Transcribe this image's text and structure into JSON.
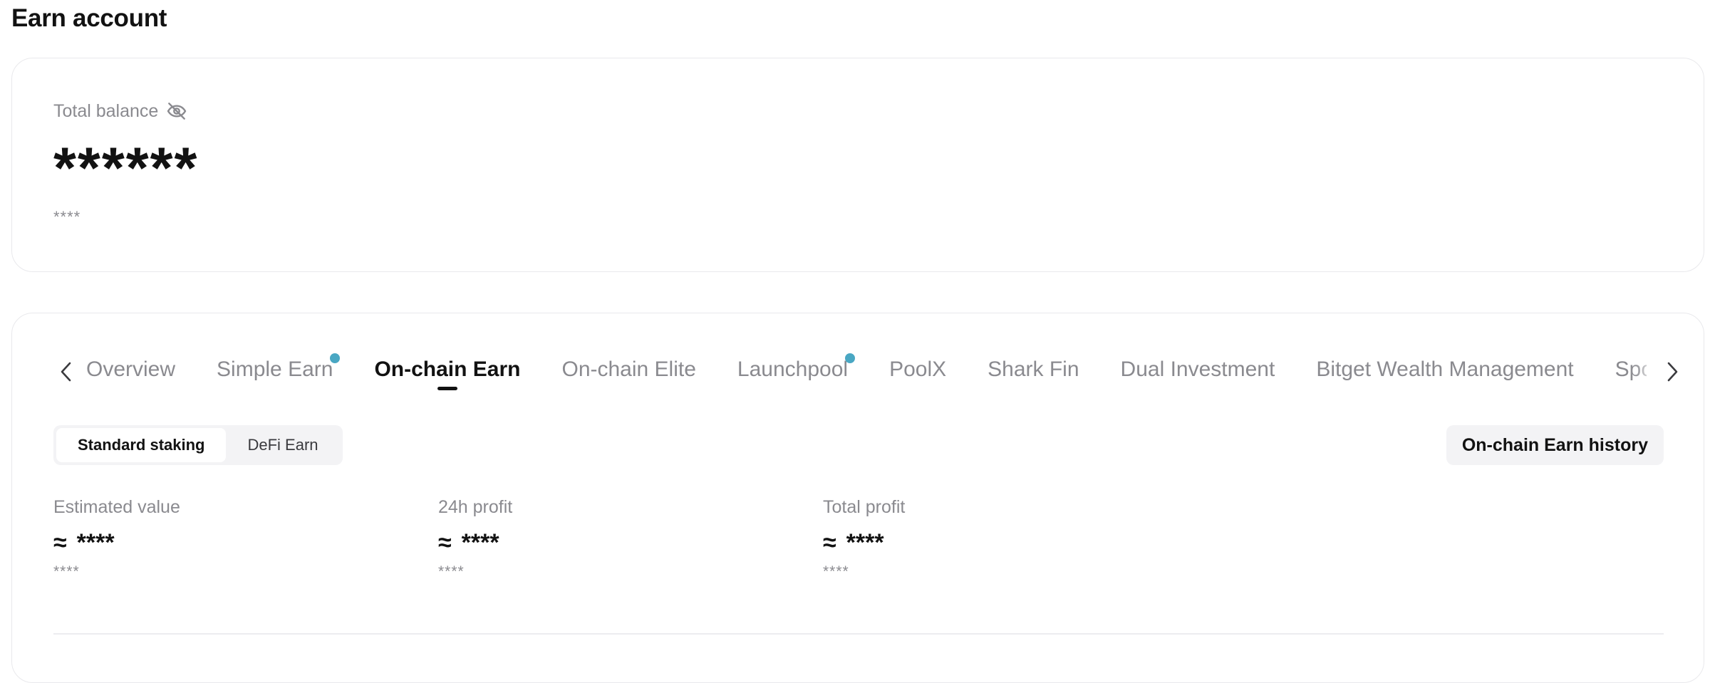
{
  "page": {
    "title": "Earn account"
  },
  "balance": {
    "label": "Total balance",
    "hidden_icon": "eye-slash-icon",
    "value": "******",
    "sub": "****"
  },
  "tabs": {
    "prev_icon": "chevron-left-icon",
    "next_icon": "chevron-right-icon",
    "items": [
      {
        "label": "Overview",
        "active": false,
        "dot": false
      },
      {
        "label": "Simple Earn",
        "active": false,
        "dot": true
      },
      {
        "label": "On-chain Earn",
        "active": true,
        "dot": false
      },
      {
        "label": "On-chain Elite",
        "active": false,
        "dot": false
      },
      {
        "label": "Launchpool",
        "active": false,
        "dot": true
      },
      {
        "label": "PoolX",
        "active": false,
        "dot": false
      },
      {
        "label": "Shark Fin",
        "active": false,
        "dot": false
      },
      {
        "label": "Dual Investment",
        "active": false,
        "dot": false
      },
      {
        "label": "Bitget Wealth Management",
        "active": false,
        "dot": false
      },
      {
        "label": "Spot au",
        "active": false,
        "dot": false
      }
    ]
  },
  "segment": {
    "standard": "Standard staking",
    "defi": "DeFi Earn"
  },
  "history_button": "On-chain Earn history",
  "stats": [
    {
      "label": "Estimated value",
      "approx": "≈",
      "value": "****",
      "sub": "****"
    },
    {
      "label": "24h profit",
      "approx": "≈",
      "value": "****",
      "sub": "****"
    },
    {
      "label": "Total profit",
      "approx": "≈",
      "value": "****",
      "sub": "****"
    }
  ],
  "colors": {
    "accent_dot": "#49a7c3",
    "muted_text": "#8a8a8f",
    "primary_text": "#121212"
  }
}
